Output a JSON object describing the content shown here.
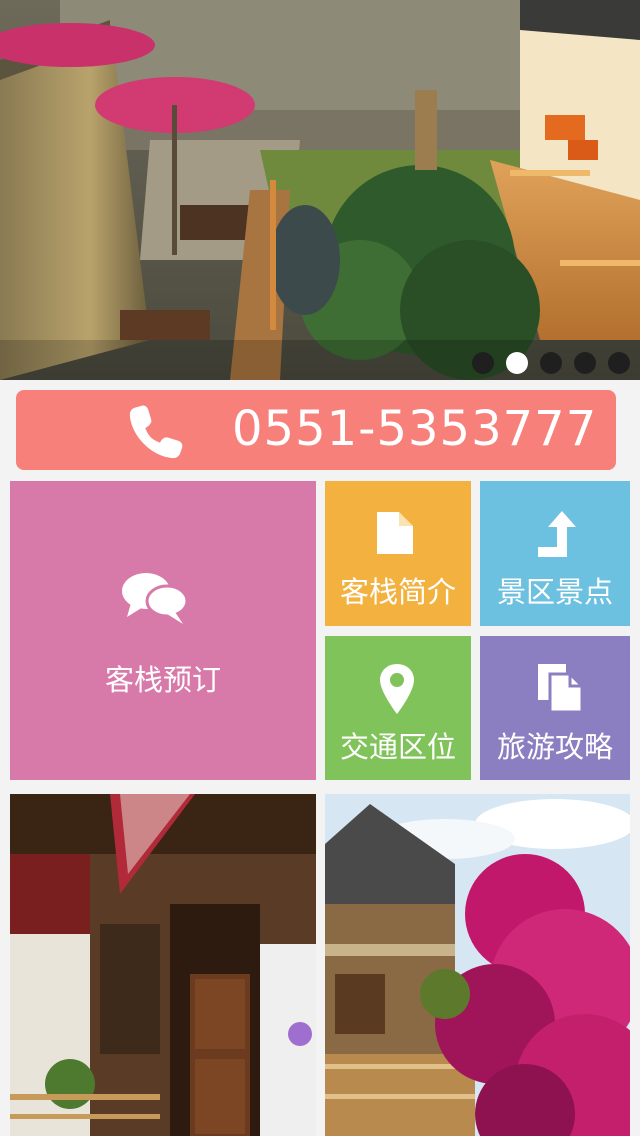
{
  "hero": {
    "slide_count": 5,
    "active_index": 1,
    "icon": "hero-photo-courtyard"
  },
  "contact": {
    "phone": "0551-5353777",
    "icon": "phone-icon",
    "color": "#f7807b"
  },
  "tiles": [
    {
      "key": "booking",
      "label": "客栈预订",
      "icon": "chat-bubbles-icon",
      "color": "#d779a9"
    },
    {
      "key": "intro",
      "label": "客栈简介",
      "icon": "document-icon",
      "color": "#f3b23f"
    },
    {
      "key": "scenic",
      "label": "景区景点",
      "icon": "turn-arrow-icon",
      "color": "#6cc0e0"
    },
    {
      "key": "traffic",
      "label": "交通区位",
      "icon": "map-pin-icon",
      "color": "#80c35a"
    },
    {
      "key": "guide",
      "label": "旅游攻略",
      "icon": "documents-icon",
      "color": "#8c7fc1"
    }
  ],
  "photos": [
    {
      "icon": "photo-wooden-house"
    },
    {
      "icon": "photo-flower-building"
    }
  ]
}
